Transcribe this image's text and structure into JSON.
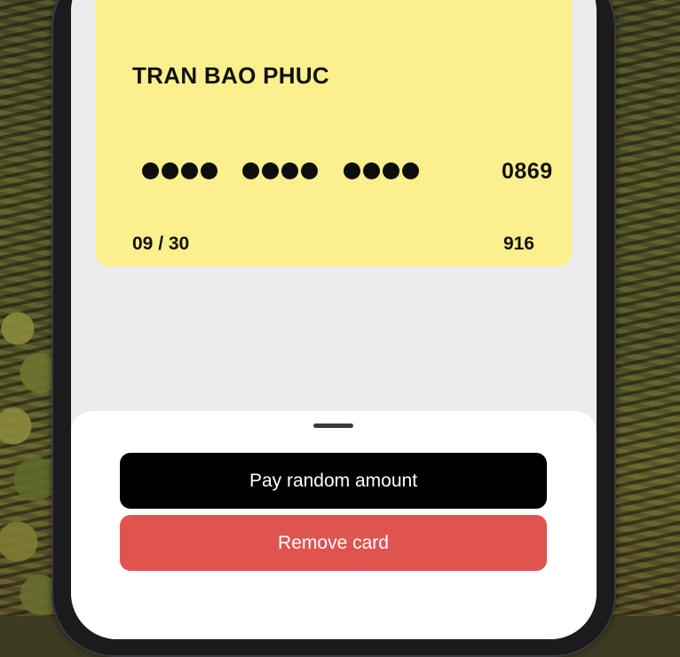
{
  "card": {
    "holder_name": "TRAN BAO PHUC",
    "masked_groups": [
      "●●●●",
      "●●●●",
      "●●●●"
    ],
    "last4": "0869",
    "expiry": "09 / 30",
    "cvv": "916",
    "color": "#fcef8d"
  },
  "sheet": {
    "pay_button_label": "Pay random amount",
    "remove_button_label": "Remove card",
    "pay_button_color": "#000000",
    "remove_button_color": "#e05450"
  }
}
